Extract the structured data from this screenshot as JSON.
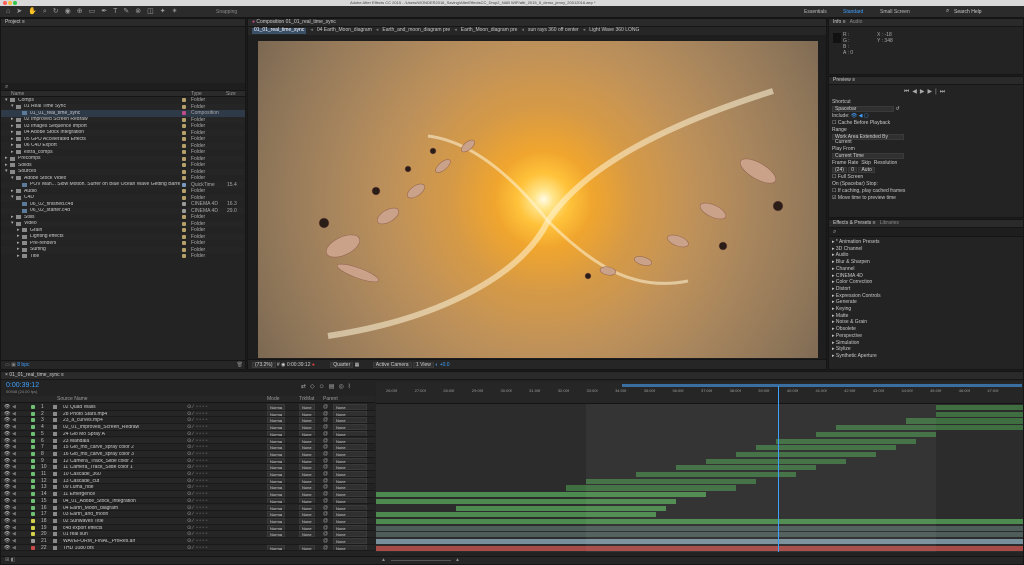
{
  "titlebar": {
    "title": "Adobe After Effects CC 2015 - /Users/WONDER2016_Saving/AfterEffectsCC_Drop2_NAB WIP/aftr_2015_5_demo_jenny_20012016.aep *"
  },
  "toolbar": {
    "snapping": "Snapping",
    "workspaces": [
      "Essentials",
      "Standard",
      "Small Screen"
    ],
    "search_placeholder": "Search Help"
  },
  "project": {
    "title": "Project",
    "columns": [
      "Name",
      "Type",
      "Size"
    ],
    "rows": [
      {
        "indent": 0,
        "twirl": "▾",
        "name": "Comps",
        "color": "#b5a06a",
        "type": "Folder",
        "size": ""
      },
      {
        "indent": 1,
        "twirl": "▾",
        "name": "01 Real Time Sync",
        "color": "#b5a06a",
        "type": "Folder",
        "size": ""
      },
      {
        "indent": 2,
        "twirl": "",
        "name": "01_01_real_time_sync",
        "color": "#c04b8a",
        "type": "Composition",
        "size": ""
      },
      {
        "indent": 1,
        "twirl": "▸",
        "name": "02 Improved Screen Redraw",
        "color": "#b5a06a",
        "type": "Folder",
        "size": ""
      },
      {
        "indent": 1,
        "twirl": "▸",
        "name": "03 Images Sequence Import",
        "color": "#b5a06a",
        "type": "Folder",
        "size": ""
      },
      {
        "indent": 1,
        "twirl": "▸",
        "name": "04 Adobe Stock Integration",
        "color": "#b5a06a",
        "type": "Folder",
        "size": ""
      },
      {
        "indent": 1,
        "twirl": "▸",
        "name": "05 GPU Accelerated Effects",
        "color": "#b5a06a",
        "type": "Folder",
        "size": ""
      },
      {
        "indent": 1,
        "twirl": "▸",
        "name": "06 C4D Export",
        "color": "#b5a06a",
        "type": "Folder",
        "size": ""
      },
      {
        "indent": 1,
        "twirl": "▸",
        "name": "extra_comps",
        "color": "#b5a06a",
        "type": "Folder",
        "size": ""
      },
      {
        "indent": 0,
        "twirl": "▸",
        "name": "Precomps",
        "color": "#b5a06a",
        "type": "Folder",
        "size": ""
      },
      {
        "indent": 0,
        "twirl": "▸",
        "name": "Solids",
        "color": "#b5a06a",
        "type": "Folder",
        "size": ""
      },
      {
        "indent": 0,
        "twirl": "▾",
        "name": "Sources",
        "color": "#b5a06a",
        "type": "Folder",
        "size": ""
      },
      {
        "indent": 1,
        "twirl": "▾",
        "name": "Adobe Stock Video",
        "color": "#b5a06a",
        "type": "Folder",
        "size": ""
      },
      {
        "indent": 2,
        "twirl": "",
        "name": "POV Man... Slow Motion. Surfer on Blue Ocean Wave Getting Barreled",
        "color": "#7a9abf",
        "type": "QuickTime",
        "size": "15.4"
      },
      {
        "indent": 1,
        "twirl": "▸",
        "name": "Audio",
        "color": "#b5a06a",
        "type": "Folder",
        "size": ""
      },
      {
        "indent": 1,
        "twirl": "▾",
        "name": "C4D",
        "color": "#b5a06a",
        "type": "Folder",
        "size": ""
      },
      {
        "indent": 2,
        "twirl": "",
        "name": "06_02_finished.c4d",
        "color": "#9a9a9a",
        "type": "CINEMA 4D",
        "size": "16.3"
      },
      {
        "indent": 2,
        "twirl": "",
        "name": "06_02_starter.c4d",
        "color": "#9a9a9a",
        "type": "CINEMA 4D",
        "size": "29.0"
      },
      {
        "indent": 1,
        "twirl": "▸",
        "name": "Stills",
        "color": "#b5a06a",
        "type": "Folder",
        "size": ""
      },
      {
        "indent": 1,
        "twirl": "▾",
        "name": "Video",
        "color": "#b5a06a",
        "type": "Folder",
        "size": ""
      },
      {
        "indent": 2,
        "twirl": "▸",
        "name": "Grain",
        "color": "#b5a06a",
        "type": "Folder",
        "size": ""
      },
      {
        "indent": 2,
        "twirl": "▸",
        "name": "Lighting effects",
        "color": "#b5a06a",
        "type": "Folder",
        "size": ""
      },
      {
        "indent": 2,
        "twirl": "▸",
        "name": "Pre-renders",
        "color": "#b5a06a",
        "type": "Folder",
        "size": ""
      },
      {
        "indent": 2,
        "twirl": "▸",
        "name": "Surfing",
        "color": "#b5a06a",
        "type": "Folder",
        "size": ""
      },
      {
        "indent": 2,
        "twirl": "▸",
        "name": "Title",
        "color": "#b5a06a",
        "type": "Folder",
        "size": ""
      }
    ],
    "footer": "8 bpc"
  },
  "composition": {
    "tab": "Composition 01_01_real_time_sync",
    "crumbs": [
      "01_01_real_time_sync",
      "04 Earth_Moon_diagram",
      "Earth_and_moon_diagram pre",
      "Earth_Moon_diagram pre",
      "sun rays 360 off center",
      "Light Wave 360 LONG"
    ],
    "footer": {
      "zoom": "(73.2%)",
      "timecode": "0:00:39:12",
      "resolution": "Quarter",
      "view": "Active Camera",
      "views": "1 View",
      "exposure": "+0.0"
    }
  },
  "info": {
    "tabs": [
      "Info",
      "Audio"
    ],
    "r": "R :",
    "g": "G :",
    "b": "B :",
    "a": "A : 0",
    "x": "X : -18",
    "y": "Y : 348"
  },
  "preview": {
    "title": "Preview",
    "shortcut_label": "Shortcut",
    "shortcut": "Spacebar",
    "include": "Include:",
    "cache": "Cache Before Playback",
    "range_label": "Range",
    "range": "Work Area Extended By Current",
    "play_from_label": "Play From",
    "play_from": "Current Time",
    "frame_rate_label": "Frame Rate",
    "skip_label": "Skip",
    "resolution_label": "Resolution",
    "frame_rate": "(24)",
    "skip": "0",
    "resolution": "Auto",
    "fullscreen": "Full Screen",
    "on_stop": "On (Spacebar) Stop:",
    "if_caching": "If caching, play cached frames",
    "move_time": "Move time to preview time"
  },
  "effects": {
    "tabs": [
      "Effects & Presets",
      "Libraries"
    ],
    "items": [
      "* Animation Presets",
      "3D Channel",
      "Audio",
      "Blur & Sharpen",
      "Channel",
      "CINEMA 4D",
      "Color Correction",
      "Distort",
      "Expression Controls",
      "Generate",
      "Keying",
      "Matte",
      "Noise & Grain",
      "Obsolete",
      "Perspective",
      "Simulation",
      "Stylize",
      "Synthetic Aperture"
    ]
  },
  "timeline": {
    "tab": "01_01_real_time_sync",
    "timecode": "0:00:39:12",
    "fps": "00948 (24.00 fps)",
    "col_source": "Source Name",
    "col_mode": "Mode",
    "col_trkmat": "TrkMat",
    "col_parent": "Parent",
    "ruler": [
      "26:00f",
      "27:00f",
      "28:00f",
      "29:00f",
      "30:00f",
      "31:00f",
      "32:00f",
      "33:00f",
      "34:00f",
      "35:00f",
      "36:00f",
      "37:00f",
      "38:00f",
      "39:00f",
      "40:00f",
      "41:00f",
      "42:00f",
      "43:00f",
      "44:00f",
      "45:00f",
      "46:00f",
      "47:00f"
    ],
    "layers": [
      {
        "num": "1",
        "name": "02 Quad Walls",
        "color": "#6fbf73",
        "mode": "Norma",
        "trk": "None",
        "parent": "None"
      },
      {
        "num": "2",
        "name": "28 Photo Stars.mp4",
        "color": "#6fbf73",
        "mode": "Norma",
        "trk": "None",
        "parent": "None"
      },
      {
        "num": "3",
        "name": "23_a_curves.mp4",
        "color": "#6fbf73",
        "mode": "Norma",
        "trk": "None",
        "parent": "None"
      },
      {
        "num": "4",
        "name": "02_01_Improved_Screen_Redraw",
        "color": "#6fbf73",
        "mode": "Norma",
        "trk": "None",
        "parent": "None"
      },
      {
        "num": "5",
        "name": "24 Glo Mo Spray A",
        "color": "#6fbf73",
        "mode": "Norma",
        "trk": "None",
        "parent": "None"
      },
      {
        "num": "6",
        "name": "23 Mandala",
        "color": "#6fbf73",
        "mode": "Norma",
        "trk": "None",
        "parent": "None"
      },
      {
        "num": "7",
        "name": "15 Glo_mo_carve_spray color 2",
        "color": "#6fbf73",
        "mode": "Norma",
        "trk": "None",
        "parent": "None"
      },
      {
        "num": "8",
        "name": "16 Glo_mo_carve_spray color 3",
        "color": "#6fbf73",
        "mode": "Norma",
        "trk": "None",
        "parent": "None"
      },
      {
        "num": "9",
        "name": "12 Camera_Track_Slide color 2",
        "color": "#6fbf73",
        "mode": "Norma",
        "trk": "None",
        "parent": "None"
      },
      {
        "num": "10",
        "name": "11 Camera_Track_Slide color 1",
        "color": "#6fbf73",
        "mode": "Norma",
        "trk": "None",
        "parent": "None"
      },
      {
        "num": "11",
        "name": "10 Cascade_360",
        "color": "#6fbf73",
        "mode": "Norma",
        "trk": "None",
        "parent": "None"
      },
      {
        "num": "12",
        "name": "13 Cascade_cut",
        "color": "#6fbf73",
        "mode": "Norma",
        "trk": "None",
        "parent": "None"
      },
      {
        "num": "13",
        "name": "09 Luma_ride",
        "color": "#6fbf73",
        "mode": "Norma",
        "trk": "None",
        "parent": "None"
      },
      {
        "num": "14",
        "name": "11 Emergence",
        "color": "#6fbf73",
        "mode": "Norma",
        "trk": "None",
        "parent": "None"
      },
      {
        "num": "15",
        "name": "04_01_Adobe_Stock_Integration",
        "color": "#6fbf73",
        "mode": "Norma",
        "trk": "None",
        "parent": "None"
      },
      {
        "num": "16",
        "name": "04 Earth_Moon_diagram",
        "color": "#6fbf73",
        "mode": "Norma",
        "trk": "None",
        "parent": "None"
      },
      {
        "num": "17",
        "name": "03 Earth_and_moon",
        "color": "#6fbf73",
        "mode": "Norma",
        "trk": "None",
        "parent": "None"
      },
      {
        "num": "18",
        "name": "02 Sunwaves Title",
        "color": "#d4d04a",
        "mode": "Norma",
        "trk": "None",
        "parent": "None"
      },
      {
        "num": "19",
        "name": "c4d export effects",
        "color": "#d4d04a",
        "mode": "Norma",
        "trk": "None",
        "parent": "None"
      },
      {
        "num": "20",
        "name": "01 real sun",
        "color": "#d4d04a",
        "mode": "Norma",
        "trk": "None",
        "parent": "None"
      },
      {
        "num": "21",
        "name": "WAVEFORM_FINAL_ProRes.aif",
        "color": "#9a9a9a",
        "mode": "",
        "trk": "",
        "parent": "None"
      },
      {
        "num": "22",
        "name": "THD 1080 bfs",
        "color": "#c94b4b",
        "mode": "Norma",
        "trk": "None",
        "parent": "None"
      }
    ]
  }
}
